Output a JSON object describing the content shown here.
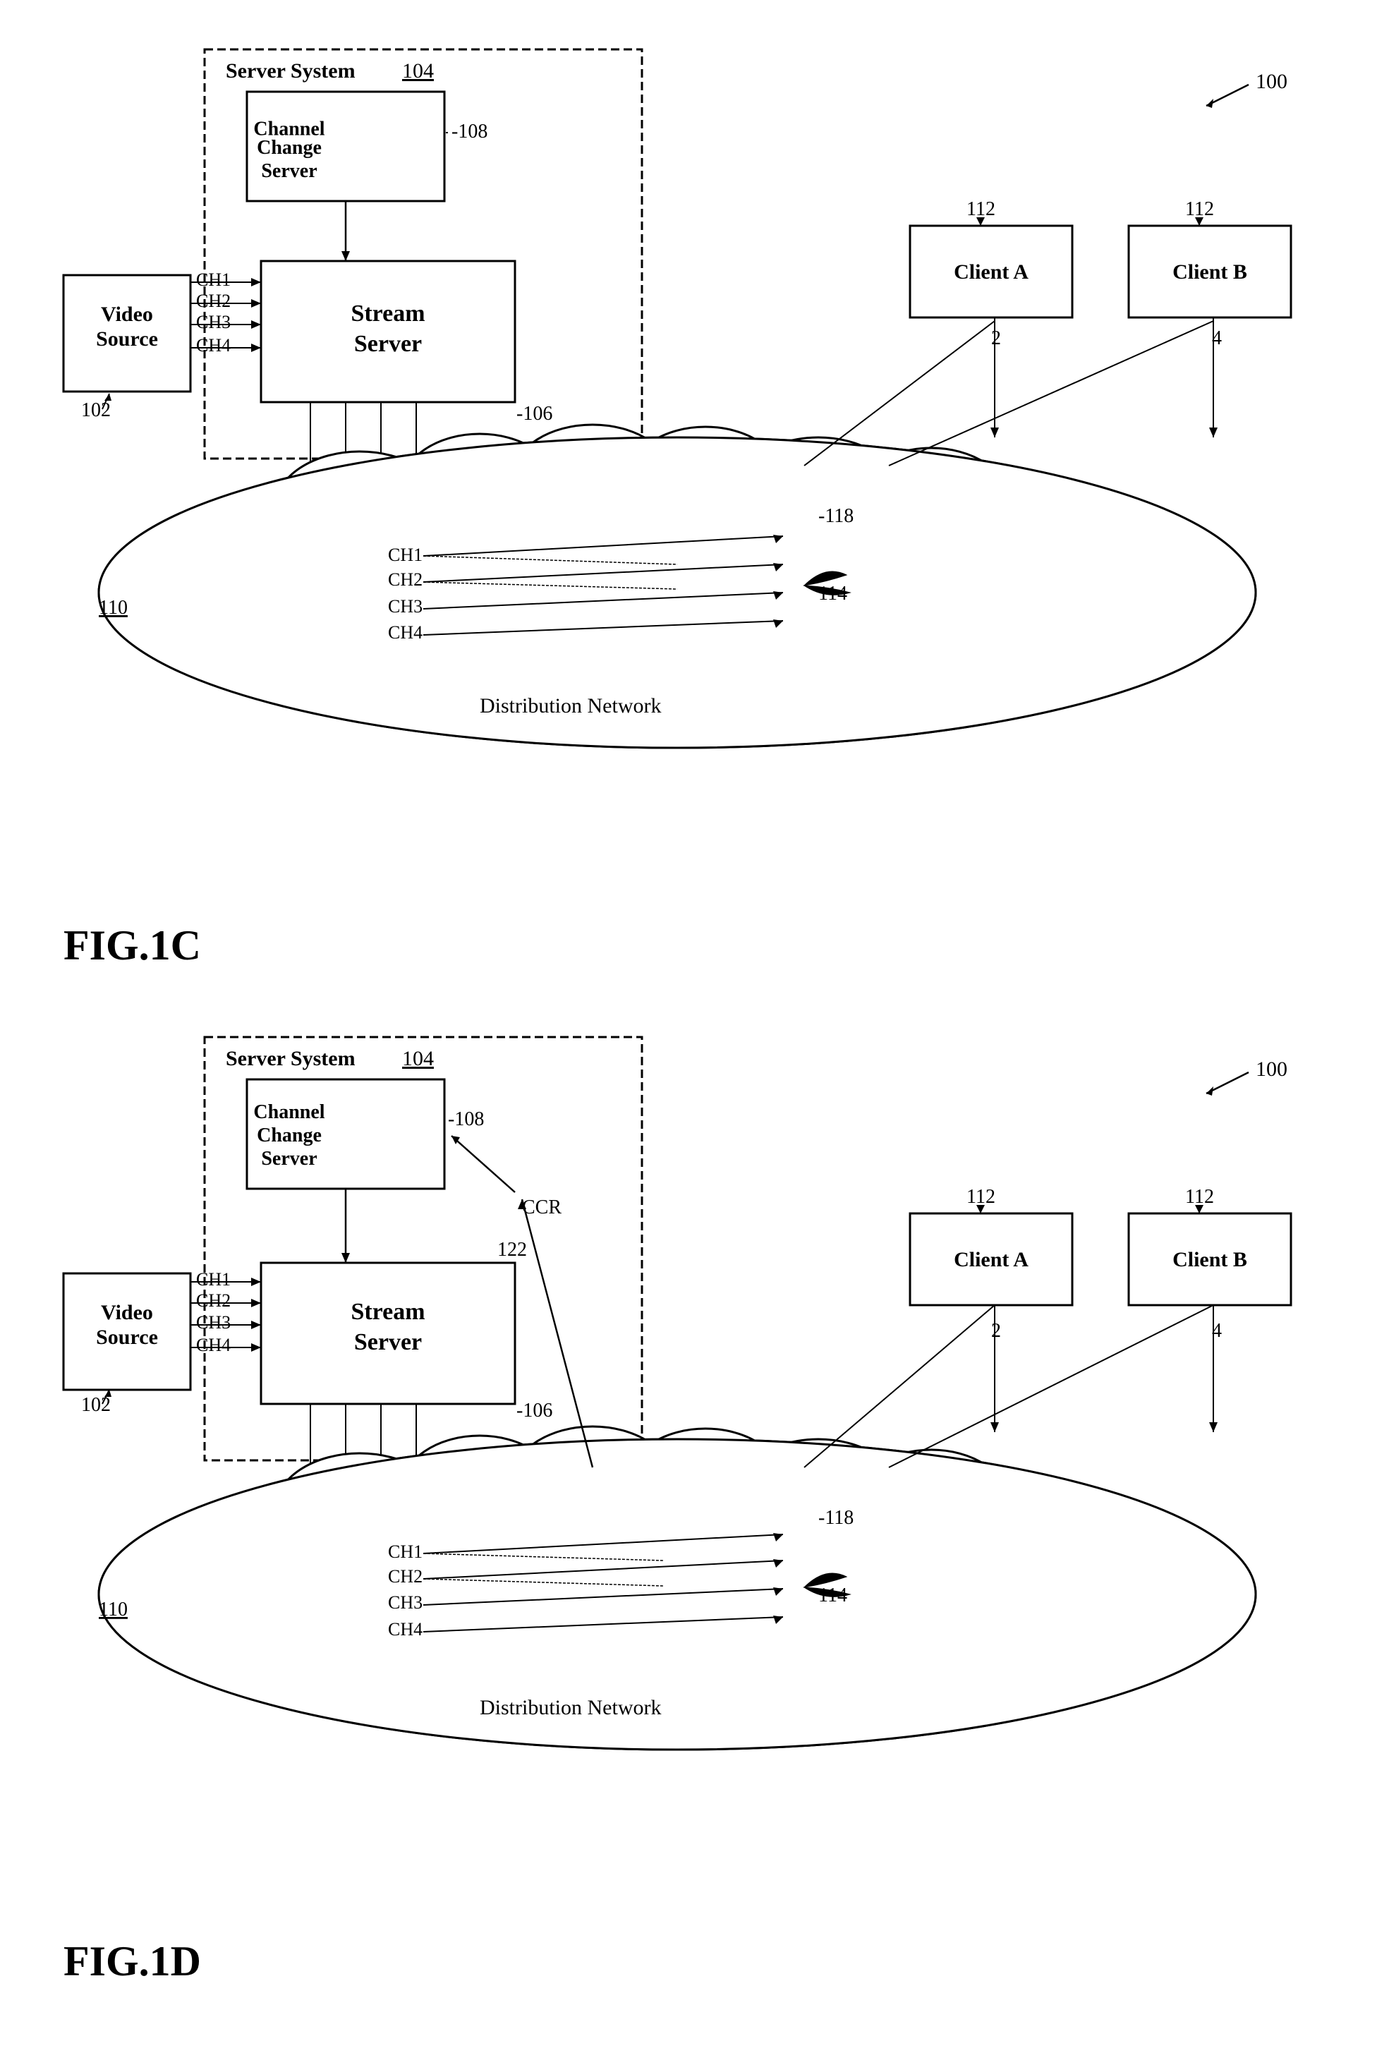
{
  "fig1c": {
    "label": "FIG.1C",
    "server_system_label": "Server System",
    "ref_104": "104",
    "channel_change_server": "Channel\nChange\nServer",
    "ref_108": "108",
    "stream_server": "Stream\nServer",
    "ref_106": "106",
    "video_source": "Video\nSource",
    "ref_102": "102",
    "client_a": "Client A",
    "client_b": "Client B",
    "ref_112a": "112",
    "ref_112b": "112",
    "ref_110": "110",
    "ref_118": "118",
    "ref_114": "114",
    "ref_2": "2",
    "ref_4": "4",
    "ref_100": "100",
    "distribution_network": "Distribution Network",
    "ch1": "CH1",
    "ch2": "CH2",
    "ch3": "CH3",
    "ch4": "CH4",
    "ch1b": "CH1",
    "ch2b": "CH2",
    "ch3b": "CH3",
    "ch4b": "CH4"
  },
  "fig1d": {
    "label": "FIG.1D",
    "server_system_label": "Server System",
    "ref_104": "104",
    "channel_change_server": "Channel\nChange\nServer",
    "ref_108": "108",
    "stream_server": "Stream\nServer",
    "ref_106": "106",
    "video_source": "Video\nSource",
    "ref_102": "102",
    "client_a": "Client A",
    "client_b": "Client B",
    "ref_112a": "112",
    "ref_112b": "112",
    "ref_110": "110",
    "ref_118": "118",
    "ref_114": "114",
    "ref_2": "2",
    "ref_4": "4",
    "ref_100": "100",
    "ref_122": "122",
    "ccr": "CCR",
    "distribution_network": "Distribution Network",
    "ch1": "CH1",
    "ch2": "CH2",
    "ch3": "CH3",
    "ch4": "CH4",
    "ch1b": "CH1",
    "ch2b": "CH2",
    "ch3b": "CH3",
    "ch4b": "CH4"
  }
}
